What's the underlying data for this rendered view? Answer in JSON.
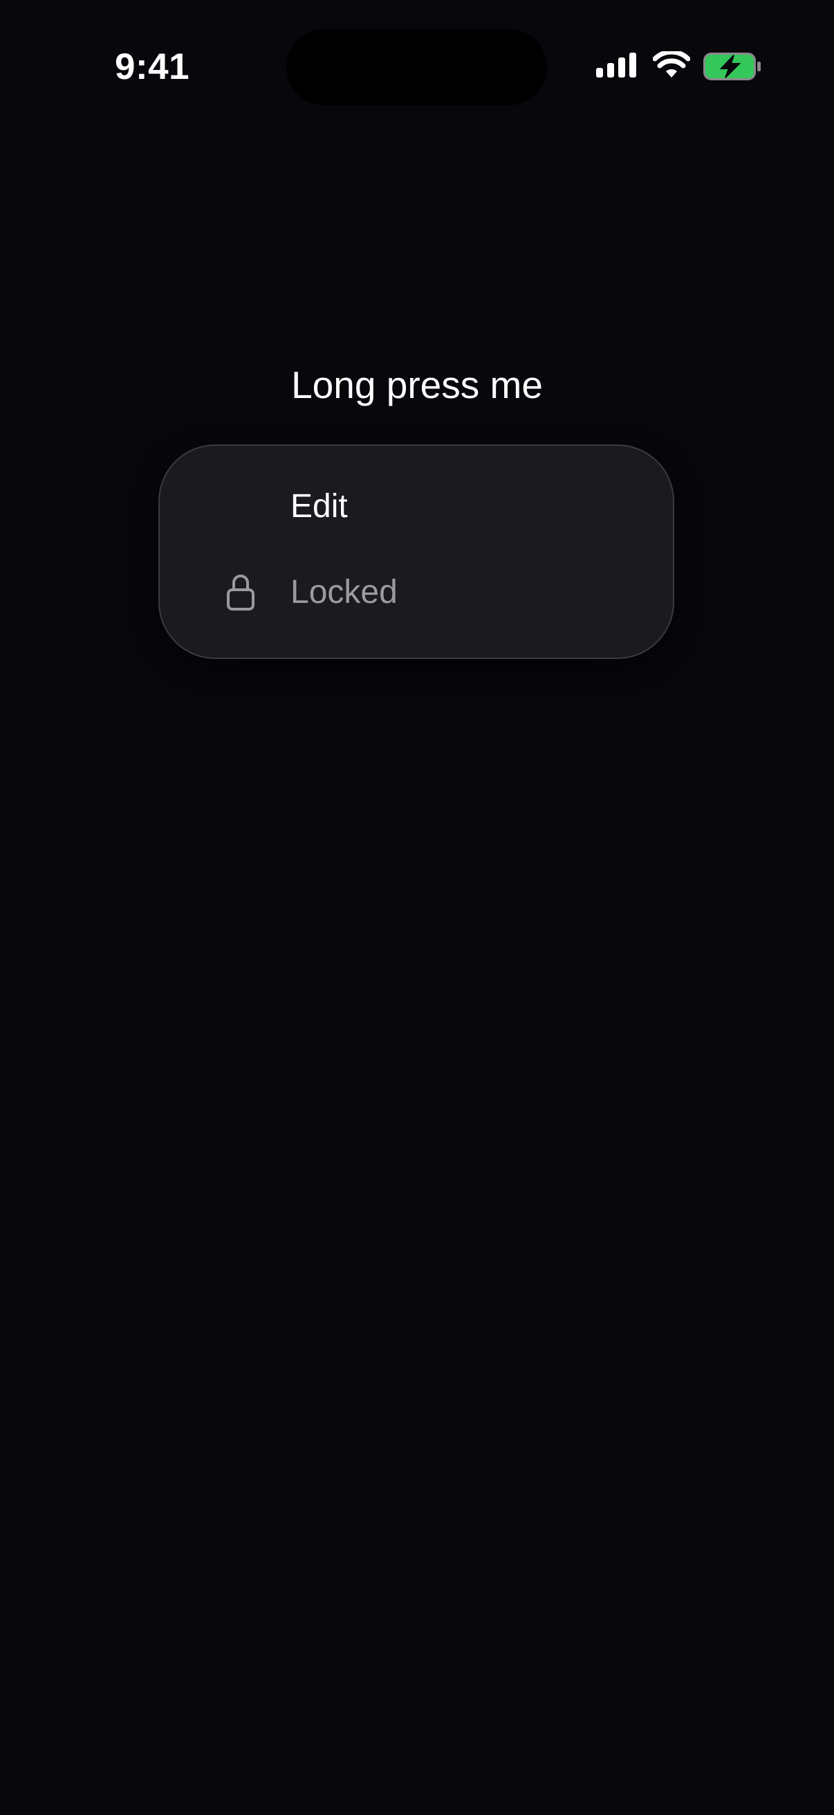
{
  "status_bar": {
    "time": "9:41",
    "icons": [
      "signal-icon",
      "wifi-icon",
      "battery-charging-icon"
    ],
    "battery_color": "#34c759"
  },
  "main": {
    "label": "Long press me"
  },
  "context_menu": {
    "items": [
      {
        "label": "Edit",
        "icon": null,
        "enabled": true
      },
      {
        "label": "Locked",
        "icon": "lock-icon",
        "enabled": false
      }
    ]
  },
  "colors": {
    "background": "#07070c",
    "menu_background": "#1b1b1f",
    "disabled_text": "#9a9aa0"
  }
}
